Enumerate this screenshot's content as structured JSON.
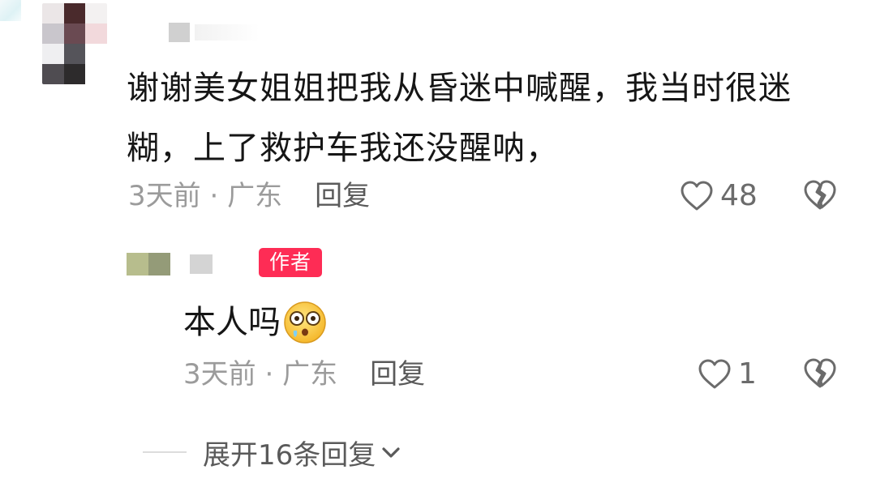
{
  "comment": {
    "text_line1": "谢谢美女姐姐把我从昏迷中喊醒，我当时很迷",
    "text_line2": "糊，上了救护车我还没醒呐，",
    "time": "3天前",
    "separator": " · ",
    "location": "广东",
    "reply_label": "回复",
    "like_count": "48",
    "like_icon": "heart-outline-icon",
    "dislike_icon": "broken-heart-icon"
  },
  "reply": {
    "badge": "作者",
    "text": "本人吗",
    "emoji": "shocked-face-emoji",
    "time": "3天前",
    "separator": " · ",
    "location": "广东",
    "reply_label": "回复",
    "like_count": "1"
  },
  "expand": {
    "label": "展开16条回复",
    "icon": "chevron-down-icon"
  },
  "colors": {
    "badge_bg": "#fe2c55",
    "meta_text": "#9b9b9b",
    "primary_text": "#161616",
    "secondary_text": "#5a5a5a"
  }
}
